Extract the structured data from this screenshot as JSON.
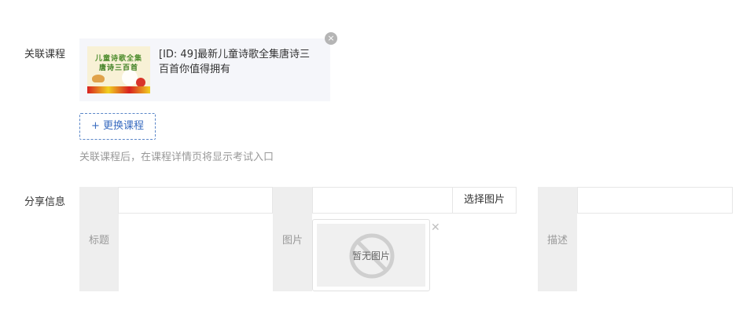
{
  "related_course": {
    "label": "关联课程",
    "course_title": "[ID: 49]最新儿童诗歌全集唐诗三百首你值得拥有",
    "thumbnail_line1": "儿童诗歌全集",
    "thumbnail_line2": "唐诗三百首",
    "remove_icon": "×",
    "change_button": "+ 更换课程",
    "hint": "关联课程后，在课程详情页将显示考试入口"
  },
  "share_info": {
    "label": "分享信息",
    "title_label": "标题",
    "title_value": "",
    "image_label": "图片",
    "image_value": "",
    "select_image_button": "选择图片",
    "no_image_text": "暂无图片",
    "image_close_icon": "✕",
    "desc_label": "描述",
    "desc_value": ""
  }
}
